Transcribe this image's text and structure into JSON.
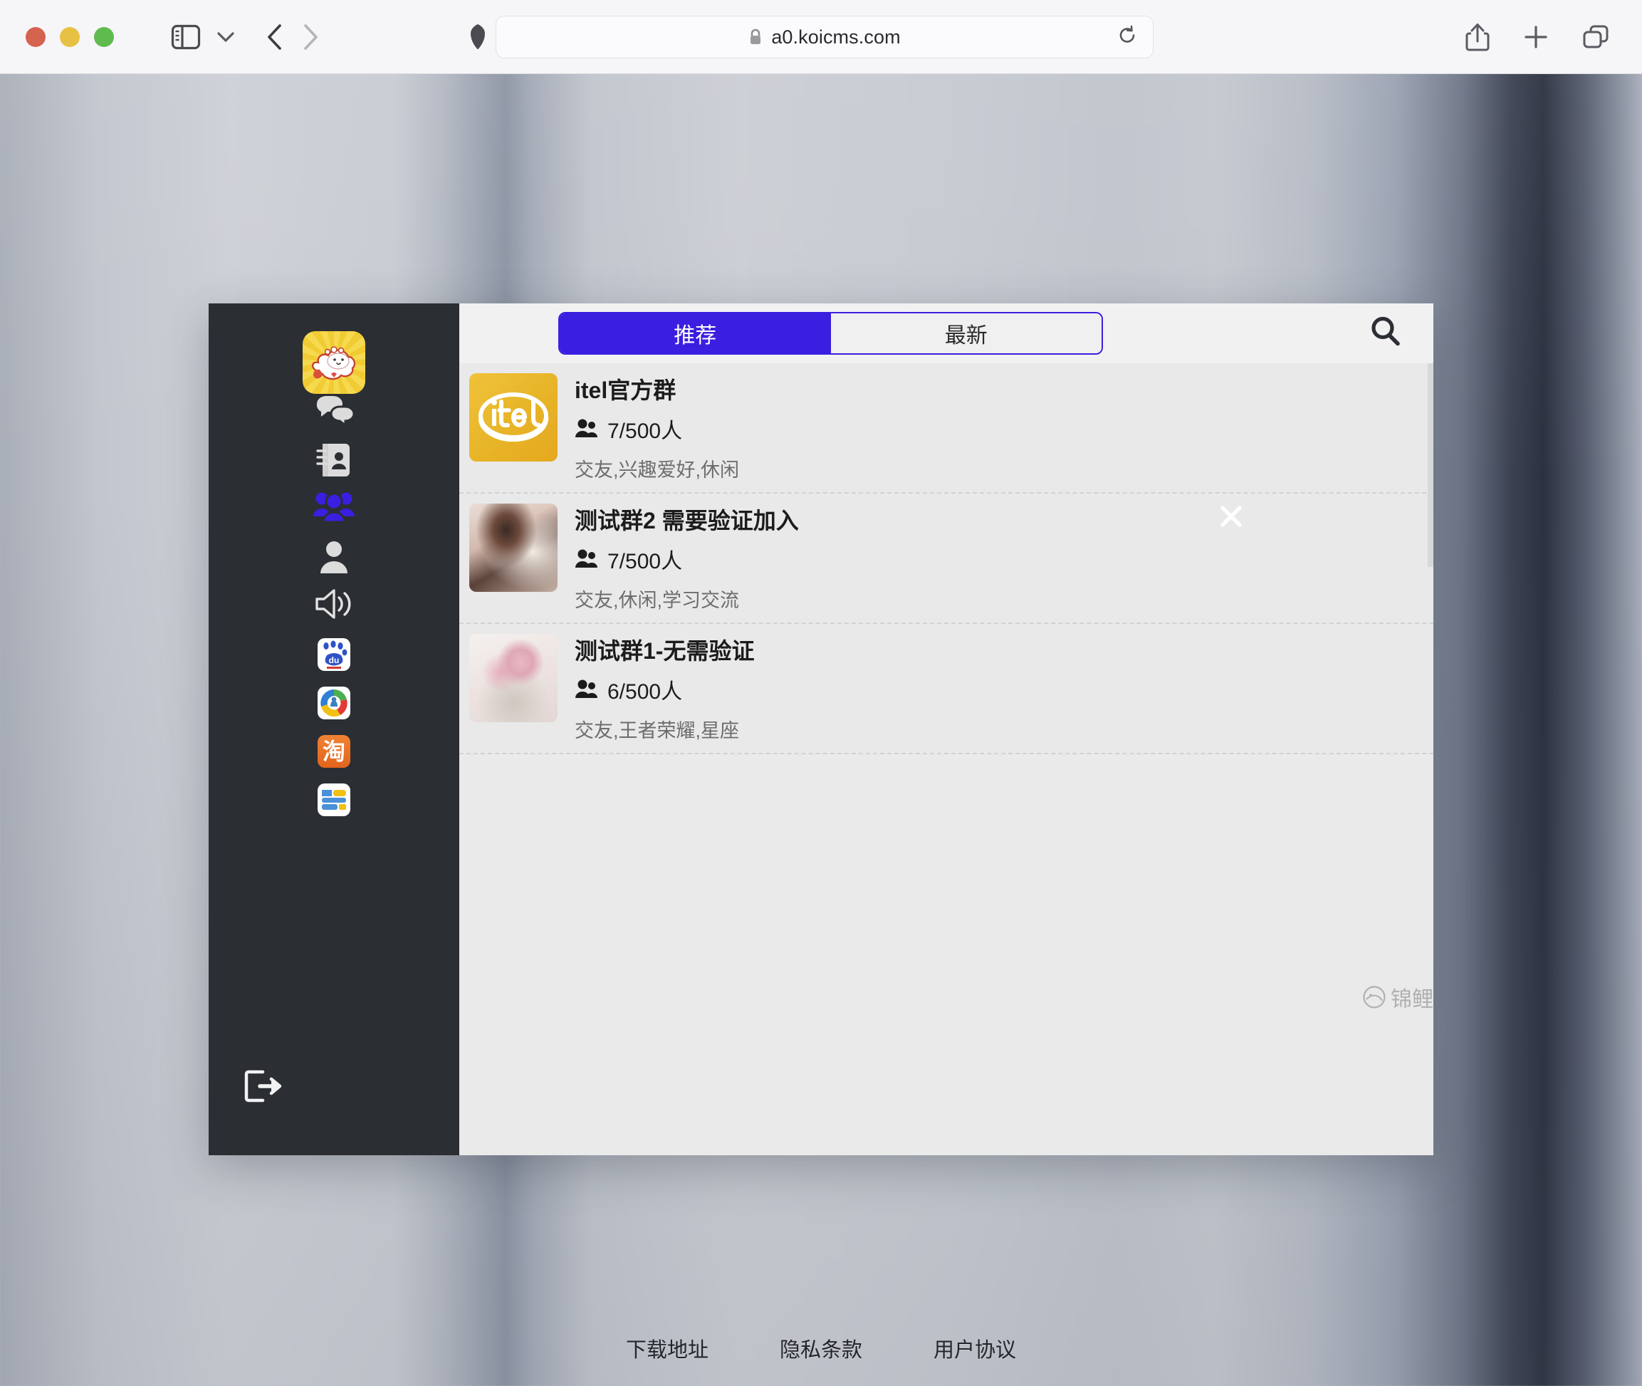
{
  "browser": {
    "url": "a0.koicms.com",
    "lock_icon": "lock-icon",
    "reload_icon": "reload-icon",
    "sidebar_icon": "sidebar-toggle-icon",
    "chevron_icon": "chevron-down-icon",
    "back_icon": "back-arrow-icon",
    "forward_icon": "forward-arrow-icon",
    "shield_icon": "shield-icon",
    "share_icon": "share-icon",
    "new_tab_icon": "plus-icon",
    "tabs_icon": "tab-overview-icon",
    "traffic_lights": [
      "close-red",
      "minimize-yellow",
      "zoom-green"
    ]
  },
  "app": {
    "sidebar": {
      "logo_name": "koi-mascot-logo",
      "items": [
        {
          "name": "chat",
          "icon": "chat-bubbles-icon",
          "active": false
        },
        {
          "name": "contacts",
          "icon": "contacts-book-icon",
          "active": false
        },
        {
          "name": "groups",
          "icon": "group-people-icon",
          "active": true
        },
        {
          "name": "profile",
          "icon": "person-icon",
          "active": false
        },
        {
          "name": "announcements",
          "icon": "speaker-icon",
          "active": false
        },
        {
          "name": "baidu",
          "icon": "baidu-app-icon",
          "active": false
        },
        {
          "name": "qq",
          "icon": "qq-app-icon",
          "active": false
        },
        {
          "name": "taobao",
          "icon": "taobao-app-icon",
          "active": false
        },
        {
          "name": "hao123",
          "icon": "hao123-app-icon",
          "active": false
        }
      ],
      "logout_icon": "logout-icon",
      "active_color": "#3a1fe0"
    },
    "header": {
      "tabs": [
        {
          "label": "推荐",
          "active": true
        },
        {
          "label": "最新",
          "active": false
        }
      ],
      "search_icon": "search-icon",
      "accent_color": "#3a1fe0"
    },
    "groups": [
      {
        "name": "itel官方群",
        "avatar": "itel-logo-avatar",
        "avatar_text": "itel",
        "members": "7/500人",
        "members_icon": "people-icon",
        "tags": "交友,兴趣爱好,休闲"
      },
      {
        "name": "测试群2 需要验证加入",
        "avatar": "woman-portrait-avatar",
        "avatar_text": "",
        "members": "7/500人",
        "members_icon": "people-icon",
        "tags": "交友,休闲,学习交流"
      },
      {
        "name": "测试群1-无需验证",
        "avatar": "flower-vase-avatar",
        "avatar_text": "",
        "members": "6/500人",
        "members_icon": "people-icon",
        "tags": "交友,王者荣耀,星座"
      }
    ],
    "close_icon": "close-x-icon",
    "watermark": {
      "text": "锦鲤",
      "icon": "koi-circle-icon"
    }
  },
  "footer": {
    "links": [
      {
        "label": "下载地址"
      },
      {
        "label": "隐私条款"
      },
      {
        "label": "用户协议"
      }
    ]
  }
}
